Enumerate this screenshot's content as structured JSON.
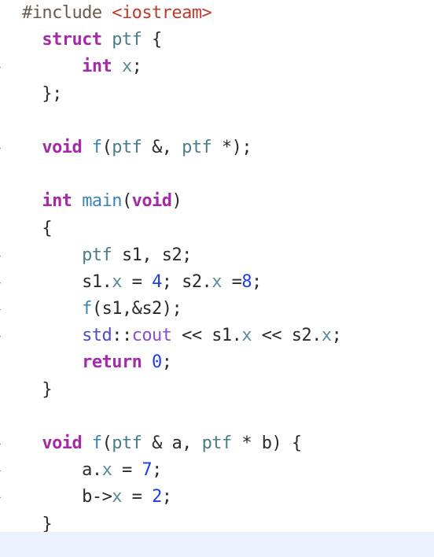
{
  "editor": {
    "name": "cpp-source-view",
    "language": "C++",
    "background_color": "#ffffff",
    "bottom_band_color": "#eaf1fd",
    "marker_color": "#3b7df0",
    "marker_icon": "chevron-right-icon",
    "marker_title": "executable line marker"
  },
  "palette": {
    "preprocessor": "#6b5a4b",
    "header": "#c0392b",
    "keyword": "#a32ba8",
    "type": "#4a7d85",
    "function": "#3b82b5",
    "number": "#1f3fe0",
    "namespace": "#4b4ec4",
    "object": "#8b4ec4",
    "member": "#5d8a96",
    "punctuation": "#2b2b2b"
  },
  "code": {
    "plain_text": "#include <iostream>\n  struct ptf {\n      int x;\n  };\n\n  void f(ptf &, ptf *);\n\n  int main(void)\n  {\n      ptf s1, s2;\n      s1.x = 4; s2.x =8;\n      f(s1,&s2);\n      std::cout << s1.x << s2.x;\n      return 0;\n  }\n\n  void f(ptf & a, ptf * b) {\n      a.x = 7;\n      b->x = 2;\n  }",
    "lines": [
      {
        "marker": false,
        "tokens": [
          {
            "t": "#include ",
            "c": "tok-pre"
          },
          {
            "t": "<iostream>",
            "c": "tok-header"
          }
        ]
      },
      {
        "marker": false,
        "tokens": [
          {
            "t": "  ",
            "c": "tok-punct"
          },
          {
            "t": "struct",
            "c": "tok-kw"
          },
          {
            "t": " ",
            "c": "tok-punct"
          },
          {
            "t": "ptf",
            "c": "tok-type"
          },
          {
            "t": " {",
            "c": "tok-punct"
          }
        ]
      },
      {
        "marker": true,
        "tokens": [
          {
            "t": "      ",
            "c": "tok-punct"
          },
          {
            "t": "int",
            "c": "tok-kw"
          },
          {
            "t": " ",
            "c": "tok-punct"
          },
          {
            "t": "x",
            "c": "tok-member"
          },
          {
            "t": ";",
            "c": "tok-punct"
          }
        ]
      },
      {
        "marker": false,
        "tokens": [
          {
            "t": "  };",
            "c": "tok-punct"
          }
        ]
      },
      {
        "marker": false,
        "tokens": [
          {
            "t": "",
            "c": "tok-punct"
          }
        ]
      },
      {
        "marker": true,
        "tokens": [
          {
            "t": "  ",
            "c": "tok-punct"
          },
          {
            "t": "void",
            "c": "tok-kw"
          },
          {
            "t": " ",
            "c": "tok-punct"
          },
          {
            "t": "f",
            "c": "tok-fn"
          },
          {
            "t": "(",
            "c": "tok-punct"
          },
          {
            "t": "ptf",
            "c": "tok-type"
          },
          {
            "t": " &, ",
            "c": "tok-punct"
          },
          {
            "t": "ptf",
            "c": "tok-type"
          },
          {
            "t": " *);",
            "c": "tok-punct"
          }
        ]
      },
      {
        "marker": false,
        "tokens": [
          {
            "t": "",
            "c": "tok-punct"
          }
        ]
      },
      {
        "marker": false,
        "tokens": [
          {
            "t": "  ",
            "c": "tok-punct"
          },
          {
            "t": "int",
            "c": "tok-kw"
          },
          {
            "t": " ",
            "c": "tok-punct"
          },
          {
            "t": "main",
            "c": "tok-fn"
          },
          {
            "t": "(",
            "c": "tok-punct"
          },
          {
            "t": "void",
            "c": "tok-kw"
          },
          {
            "t": ")",
            "c": "tok-punct"
          }
        ]
      },
      {
        "marker": false,
        "tokens": [
          {
            "t": "  {",
            "c": "tok-punct"
          }
        ]
      },
      {
        "marker": true,
        "tokens": [
          {
            "t": "      ",
            "c": "tok-punct"
          },
          {
            "t": "ptf",
            "c": "tok-type"
          },
          {
            "t": " ",
            "c": "tok-punct"
          },
          {
            "t": "s1",
            "c": "tok-var"
          },
          {
            "t": ", ",
            "c": "tok-punct"
          },
          {
            "t": "s2",
            "c": "tok-var"
          },
          {
            "t": ";",
            "c": "tok-punct"
          }
        ]
      },
      {
        "marker": true,
        "tokens": [
          {
            "t": "      ",
            "c": "tok-punct"
          },
          {
            "t": "s1",
            "c": "tok-var"
          },
          {
            "t": ".",
            "c": "tok-punct"
          },
          {
            "t": "x",
            "c": "tok-member"
          },
          {
            "t": " = ",
            "c": "tok-op"
          },
          {
            "t": "4",
            "c": "tok-num"
          },
          {
            "t": "; ",
            "c": "tok-punct"
          },
          {
            "t": "s2",
            "c": "tok-var"
          },
          {
            "t": ".",
            "c": "tok-punct"
          },
          {
            "t": "x",
            "c": "tok-member"
          },
          {
            "t": " =",
            "c": "tok-op"
          },
          {
            "t": "8",
            "c": "tok-num"
          },
          {
            "t": ";",
            "c": "tok-punct"
          }
        ]
      },
      {
        "marker": true,
        "tokens": [
          {
            "t": "      ",
            "c": "tok-punct"
          },
          {
            "t": "f",
            "c": "tok-fn"
          },
          {
            "t": "(",
            "c": "tok-punct"
          },
          {
            "t": "s1",
            "c": "tok-var"
          },
          {
            "t": ",&",
            "c": "tok-punct"
          },
          {
            "t": "s2",
            "c": "tok-var"
          },
          {
            "t": ");",
            "c": "tok-punct"
          }
        ]
      },
      {
        "marker": true,
        "tokens": [
          {
            "t": "      ",
            "c": "tok-punct"
          },
          {
            "t": "std",
            "c": "tok-ns"
          },
          {
            "t": "::",
            "c": "tok-punct"
          },
          {
            "t": "cout",
            "c": "tok-obj"
          },
          {
            "t": " << ",
            "c": "tok-op"
          },
          {
            "t": "s1",
            "c": "tok-var"
          },
          {
            "t": ".",
            "c": "tok-punct"
          },
          {
            "t": "x",
            "c": "tok-member"
          },
          {
            "t": " << ",
            "c": "tok-op"
          },
          {
            "t": "s2",
            "c": "tok-var"
          },
          {
            "t": ".",
            "c": "tok-punct"
          },
          {
            "t": "x",
            "c": "tok-member"
          },
          {
            "t": ";",
            "c": "tok-punct"
          }
        ]
      },
      {
        "marker": false,
        "tokens": [
          {
            "t": "      ",
            "c": "tok-punct"
          },
          {
            "t": "return",
            "c": "tok-kw"
          },
          {
            "t": " ",
            "c": "tok-punct"
          },
          {
            "t": "0",
            "c": "tok-num"
          },
          {
            "t": ";",
            "c": "tok-punct"
          }
        ]
      },
      {
        "marker": false,
        "tokens": [
          {
            "t": "  }",
            "c": "tok-punct"
          }
        ]
      },
      {
        "marker": false,
        "tokens": [
          {
            "t": "",
            "c": "tok-punct"
          }
        ]
      },
      {
        "marker": true,
        "tokens": [
          {
            "t": "  ",
            "c": "tok-punct"
          },
          {
            "t": "void",
            "c": "tok-kw"
          },
          {
            "t": " ",
            "c": "tok-punct"
          },
          {
            "t": "f",
            "c": "tok-fn"
          },
          {
            "t": "(",
            "c": "tok-punct"
          },
          {
            "t": "ptf",
            "c": "tok-type"
          },
          {
            "t": " & ",
            "c": "tok-punct"
          },
          {
            "t": "a",
            "c": "tok-var"
          },
          {
            "t": ", ",
            "c": "tok-punct"
          },
          {
            "t": "ptf",
            "c": "tok-type"
          },
          {
            "t": " * ",
            "c": "tok-punct"
          },
          {
            "t": "b",
            "c": "tok-var"
          },
          {
            "t": ") {",
            "c": "tok-punct"
          }
        ]
      },
      {
        "marker": true,
        "tokens": [
          {
            "t": "      ",
            "c": "tok-punct"
          },
          {
            "t": "a",
            "c": "tok-var"
          },
          {
            "t": ".",
            "c": "tok-punct"
          },
          {
            "t": "x",
            "c": "tok-member"
          },
          {
            "t": " = ",
            "c": "tok-op"
          },
          {
            "t": "7",
            "c": "tok-num"
          },
          {
            "t": ";",
            "c": "tok-punct"
          }
        ]
      },
      {
        "marker": true,
        "tokens": [
          {
            "t": "      ",
            "c": "tok-punct"
          },
          {
            "t": "b",
            "c": "tok-var"
          },
          {
            "t": "->",
            "c": "tok-op"
          },
          {
            "t": "x",
            "c": "tok-member"
          },
          {
            "t": " = ",
            "c": "tok-op"
          },
          {
            "t": "2",
            "c": "tok-num"
          },
          {
            "t": ";",
            "c": "tok-punct"
          }
        ]
      },
      {
        "marker": false,
        "tokens": [
          {
            "t": "  }",
            "c": "tok-punct"
          }
        ]
      }
    ]
  }
}
